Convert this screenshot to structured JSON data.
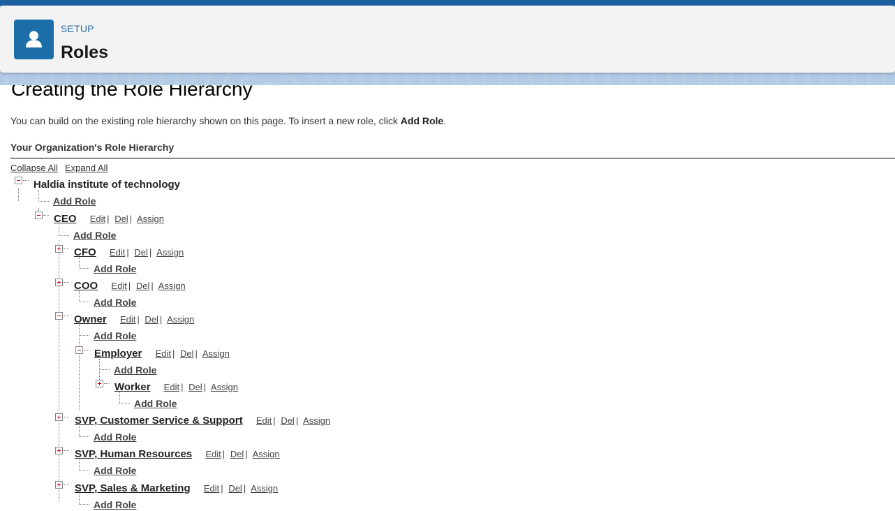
{
  "header": {
    "kicker": "SETUP",
    "title": "Roles",
    "icon": "user-icon",
    "accent": "#1b6ea8"
  },
  "page": {
    "heading": "Creating the Role Hierarchy",
    "intro_prefix": "You can build on the existing role hierarchy shown on this page. To insert a new role, click ",
    "intro_bold": "Add Role",
    "intro_suffix": ".",
    "section_title": "Your Organization's Role Hierarchy",
    "collapse_all": "Collapse All",
    "expand_all": "Expand All"
  },
  "labels": {
    "add_role": "Add Role",
    "edit": "Edit",
    "del": "Del",
    "assign": "Assign",
    "sep": "|"
  },
  "tree": {
    "root": {
      "name": "Haldia institute of technology",
      "state": "expanded"
    },
    "roles": [
      {
        "name": "CEO",
        "state": "expanded"
      },
      {
        "name": "CFO",
        "state": "collapsed"
      },
      {
        "name": "COO",
        "state": "collapsed"
      },
      {
        "name": "Owner",
        "state": "expanded"
      },
      {
        "name": "Employer",
        "state": "expanded"
      },
      {
        "name": "Worker",
        "state": "collapsed"
      },
      {
        "name": "SVP, Customer Service & Support",
        "state": "collapsed"
      },
      {
        "name": "SVP, Human Resources",
        "state": "collapsed"
      },
      {
        "name": "SVP, Sales & Marketing",
        "state": "collapsed"
      }
    ]
  }
}
